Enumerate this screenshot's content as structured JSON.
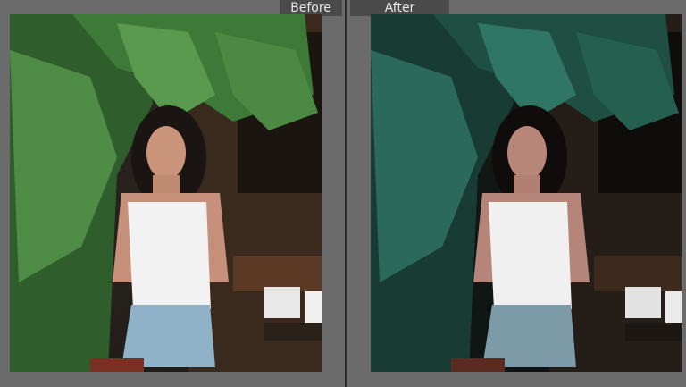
{
  "labels": {
    "before": "Before",
    "after": "After"
  },
  "colors": {
    "background": "#6f6f6f",
    "tab_bg": "#4a4a4a",
    "tab_text": "#e6e6e6",
    "divider": "#2a2a2a",
    "before_tint": "#3f6b3a",
    "after_tint": "#1f4a3a"
  }
}
